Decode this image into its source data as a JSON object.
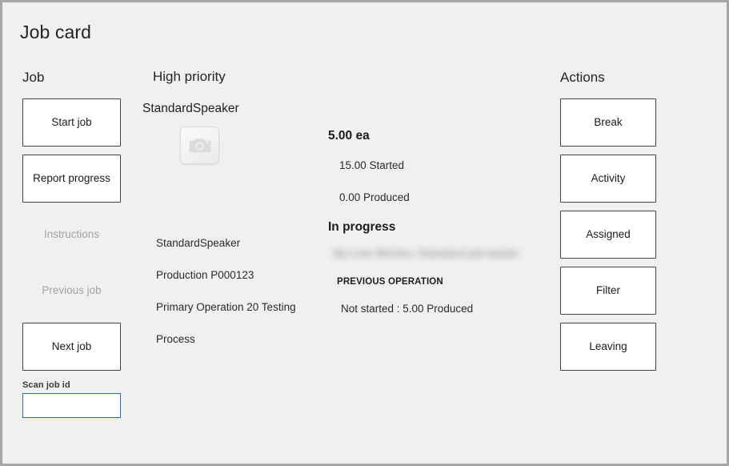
{
  "window": {
    "title": "Job card",
    "background_color": "#f1f0ef",
    "border_color": "#a6a6a6"
  },
  "columns": {
    "job": {
      "heading": "Job",
      "buttons": [
        {
          "label": "Start job",
          "enabled": true
        },
        {
          "label": "Report progress",
          "enabled": true
        },
        {
          "label": "Instructions",
          "enabled": false
        },
        {
          "label": "Previous job",
          "enabled": false
        },
        {
          "label": "Next job",
          "enabled": true
        }
      ],
      "scan_field": {
        "label": "Scan job id",
        "value": "",
        "placeholder": "",
        "focus_border_color": "#2a64c4"
      }
    },
    "priority": {
      "heading": "High priority",
      "product_title": "StandardSpeaker",
      "image_placeholder_icon": "camera-icon",
      "details": [
        "StandardSpeaker",
        "Production P000123",
        "Primary Operation 20 Testing",
        "Process"
      ]
    },
    "quantities": {
      "total": "5.00 ea",
      "started": "15.00 Started",
      "produced": "0.00 Produced",
      "status": "In progress",
      "redacted_line": "By Line Worker, Standard job leader",
      "previous_operation_label": "PREVIOUS OPERATION",
      "previous_operation_value": "Not started : 5.00 Produced"
    },
    "actions": {
      "heading": "Actions",
      "buttons": [
        {
          "label": "Break"
        },
        {
          "label": "Activity"
        },
        {
          "label": "Assigned"
        },
        {
          "label": "Filter"
        },
        {
          "label": "Leaving"
        }
      ]
    }
  }
}
